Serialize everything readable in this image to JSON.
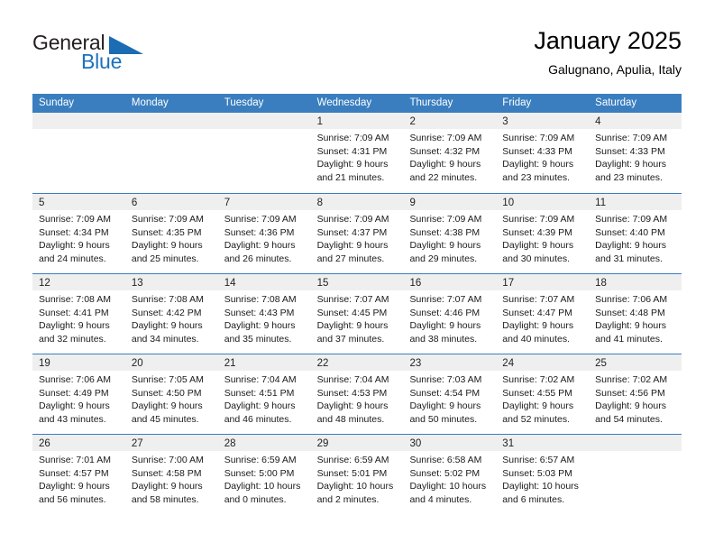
{
  "logo": {
    "word1": "General",
    "word2": "Blue",
    "triangle_color": "#1b6cb3",
    "word2_color": "#1b72bd"
  },
  "header": {
    "title": "January 2025",
    "subtitle": "Galugnano, Apulia, Italy"
  },
  "theme": {
    "header_bg": "#3a7ebf",
    "header_text": "#ffffff",
    "daynum_band": "#efefef",
    "row_divider": "#3a7ebf"
  },
  "weekdays": [
    "Sunday",
    "Monday",
    "Tuesday",
    "Wednesday",
    "Thursday",
    "Friday",
    "Saturday"
  ],
  "weeks": [
    [
      {
        "day": "",
        "lines": []
      },
      {
        "day": "",
        "lines": []
      },
      {
        "day": "",
        "lines": []
      },
      {
        "day": "1",
        "lines": [
          "Sunrise: 7:09 AM",
          "Sunset: 4:31 PM",
          "Daylight: 9 hours",
          "and 21 minutes."
        ]
      },
      {
        "day": "2",
        "lines": [
          "Sunrise: 7:09 AM",
          "Sunset: 4:32 PM",
          "Daylight: 9 hours",
          "and 22 minutes."
        ]
      },
      {
        "day": "3",
        "lines": [
          "Sunrise: 7:09 AM",
          "Sunset: 4:33 PM",
          "Daylight: 9 hours",
          "and 23 minutes."
        ]
      },
      {
        "day": "4",
        "lines": [
          "Sunrise: 7:09 AM",
          "Sunset: 4:33 PM",
          "Daylight: 9 hours",
          "and 23 minutes."
        ]
      }
    ],
    [
      {
        "day": "5",
        "lines": [
          "Sunrise: 7:09 AM",
          "Sunset: 4:34 PM",
          "Daylight: 9 hours",
          "and 24 minutes."
        ]
      },
      {
        "day": "6",
        "lines": [
          "Sunrise: 7:09 AM",
          "Sunset: 4:35 PM",
          "Daylight: 9 hours",
          "and 25 minutes."
        ]
      },
      {
        "day": "7",
        "lines": [
          "Sunrise: 7:09 AM",
          "Sunset: 4:36 PM",
          "Daylight: 9 hours",
          "and 26 minutes."
        ]
      },
      {
        "day": "8",
        "lines": [
          "Sunrise: 7:09 AM",
          "Sunset: 4:37 PM",
          "Daylight: 9 hours",
          "and 27 minutes."
        ]
      },
      {
        "day": "9",
        "lines": [
          "Sunrise: 7:09 AM",
          "Sunset: 4:38 PM",
          "Daylight: 9 hours",
          "and 29 minutes."
        ]
      },
      {
        "day": "10",
        "lines": [
          "Sunrise: 7:09 AM",
          "Sunset: 4:39 PM",
          "Daylight: 9 hours",
          "and 30 minutes."
        ]
      },
      {
        "day": "11",
        "lines": [
          "Sunrise: 7:09 AM",
          "Sunset: 4:40 PM",
          "Daylight: 9 hours",
          "and 31 minutes."
        ]
      }
    ],
    [
      {
        "day": "12",
        "lines": [
          "Sunrise: 7:08 AM",
          "Sunset: 4:41 PM",
          "Daylight: 9 hours",
          "and 32 minutes."
        ]
      },
      {
        "day": "13",
        "lines": [
          "Sunrise: 7:08 AM",
          "Sunset: 4:42 PM",
          "Daylight: 9 hours",
          "and 34 minutes."
        ]
      },
      {
        "day": "14",
        "lines": [
          "Sunrise: 7:08 AM",
          "Sunset: 4:43 PM",
          "Daylight: 9 hours",
          "and 35 minutes."
        ]
      },
      {
        "day": "15",
        "lines": [
          "Sunrise: 7:07 AM",
          "Sunset: 4:45 PM",
          "Daylight: 9 hours",
          "and 37 minutes."
        ]
      },
      {
        "day": "16",
        "lines": [
          "Sunrise: 7:07 AM",
          "Sunset: 4:46 PM",
          "Daylight: 9 hours",
          "and 38 minutes."
        ]
      },
      {
        "day": "17",
        "lines": [
          "Sunrise: 7:07 AM",
          "Sunset: 4:47 PM",
          "Daylight: 9 hours",
          "and 40 minutes."
        ]
      },
      {
        "day": "18",
        "lines": [
          "Sunrise: 7:06 AM",
          "Sunset: 4:48 PM",
          "Daylight: 9 hours",
          "and 41 minutes."
        ]
      }
    ],
    [
      {
        "day": "19",
        "lines": [
          "Sunrise: 7:06 AM",
          "Sunset: 4:49 PM",
          "Daylight: 9 hours",
          "and 43 minutes."
        ]
      },
      {
        "day": "20",
        "lines": [
          "Sunrise: 7:05 AM",
          "Sunset: 4:50 PM",
          "Daylight: 9 hours",
          "and 45 minutes."
        ]
      },
      {
        "day": "21",
        "lines": [
          "Sunrise: 7:04 AM",
          "Sunset: 4:51 PM",
          "Daylight: 9 hours",
          "and 46 minutes."
        ]
      },
      {
        "day": "22",
        "lines": [
          "Sunrise: 7:04 AM",
          "Sunset: 4:53 PM",
          "Daylight: 9 hours",
          "and 48 minutes."
        ]
      },
      {
        "day": "23",
        "lines": [
          "Sunrise: 7:03 AM",
          "Sunset: 4:54 PM",
          "Daylight: 9 hours",
          "and 50 minutes."
        ]
      },
      {
        "day": "24",
        "lines": [
          "Sunrise: 7:02 AM",
          "Sunset: 4:55 PM",
          "Daylight: 9 hours",
          "and 52 minutes."
        ]
      },
      {
        "day": "25",
        "lines": [
          "Sunrise: 7:02 AM",
          "Sunset: 4:56 PM",
          "Daylight: 9 hours",
          "and 54 minutes."
        ]
      }
    ],
    [
      {
        "day": "26",
        "lines": [
          "Sunrise: 7:01 AM",
          "Sunset: 4:57 PM",
          "Daylight: 9 hours",
          "and 56 minutes."
        ]
      },
      {
        "day": "27",
        "lines": [
          "Sunrise: 7:00 AM",
          "Sunset: 4:58 PM",
          "Daylight: 9 hours",
          "and 58 minutes."
        ]
      },
      {
        "day": "28",
        "lines": [
          "Sunrise: 6:59 AM",
          "Sunset: 5:00 PM",
          "Daylight: 10 hours",
          "and 0 minutes."
        ]
      },
      {
        "day": "29",
        "lines": [
          "Sunrise: 6:59 AM",
          "Sunset: 5:01 PM",
          "Daylight: 10 hours",
          "and 2 minutes."
        ]
      },
      {
        "day": "30",
        "lines": [
          "Sunrise: 6:58 AM",
          "Sunset: 5:02 PM",
          "Daylight: 10 hours",
          "and 4 minutes."
        ]
      },
      {
        "day": "31",
        "lines": [
          "Sunrise: 6:57 AM",
          "Sunset: 5:03 PM",
          "Daylight: 10 hours",
          "and 6 minutes."
        ]
      },
      {
        "day": "",
        "lines": []
      }
    ]
  ]
}
